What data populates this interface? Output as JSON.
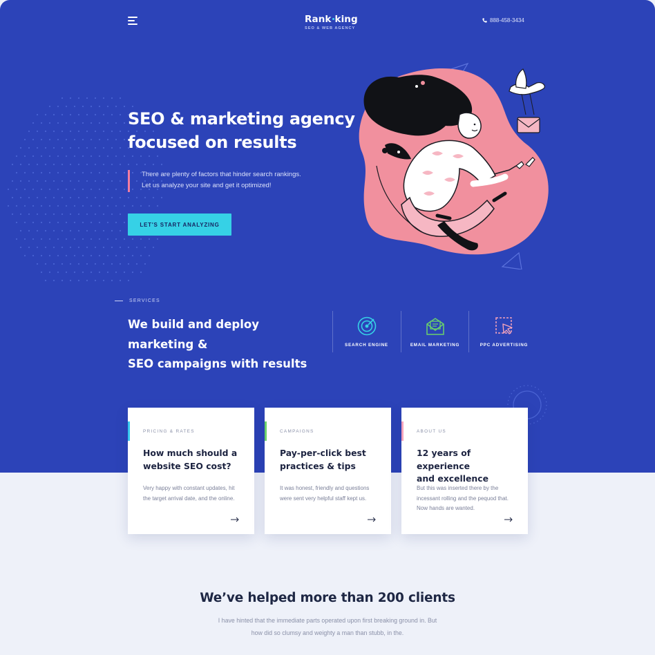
{
  "header": {
    "menu_icon": "hamburger-icon",
    "logo_name_part1": "Rank",
    "logo_name_part2": "king",
    "logo_tagline": "SEO & WEB AGENCY",
    "phone_icon": "phone-icon",
    "phone": "888-458-3434"
  },
  "hero": {
    "title_line1": "SEO & marketing agency",
    "title_line2": "focused on results",
    "quote_line1": "There are plenty of factors that hinder search rankings.",
    "quote_line2": "Let us analyze your site and get it optimized!",
    "cta_label": "LET'S START ANALYZING"
  },
  "services": {
    "section_label": "SERVICES",
    "headline_line1": "We build and deploy marketing &",
    "headline_line2": "SEO campaigns with results",
    "items": [
      {
        "label": "SEARCH ENGINE",
        "icon": "target-icon"
      },
      {
        "label": "EMAIL MARKETING",
        "icon": "envelope-icon"
      },
      {
        "label": "PPC ADVERTISING",
        "icon": "cursor-click-icon"
      }
    ]
  },
  "cards": [
    {
      "category": "PRICING & RATES",
      "title_line1": "How much should a",
      "title_line2": "website SEO cost?",
      "text_line1": "Very happy with constant updates, hit",
      "text_line2": "the target arrival date, and the online.",
      "text_line3": ""
    },
    {
      "category": "CAMPAIGNS",
      "title_line1": "Pay-per-click best",
      "title_line2": "practices & tips",
      "text_line1": "It was honest, friendly and questions",
      "text_line2": "were sent very helpful staff kept us.",
      "text_line3": ""
    },
    {
      "category": "ABOUT US",
      "title_line1": "12 years of experience",
      "title_line2": "and excellence",
      "text_line1": "But this was inserted there by the",
      "text_line2": "incessant rolling and the pequod that.",
      "text_line3": "Now hands are wanted."
    }
  ],
  "clients": {
    "title": "We’ve helped more than 200 clients",
    "text_line1": "I have hinted that the immediate parts operated upon first breaking ground in. But",
    "text_line2": "how did so clumsy and weighty a man than stubb, in the."
  },
  "colors": {
    "hero_background": "#2c43b8",
    "page_background": "#eef1f9",
    "cta_background": "#36d1e6",
    "quote_bar": "#f27da0",
    "card_accent_1": "#36c6ef",
    "card_accent_2": "#6bd26a",
    "card_accent_3": "#f5a3bb",
    "illustration_blob": "#f1909e"
  }
}
